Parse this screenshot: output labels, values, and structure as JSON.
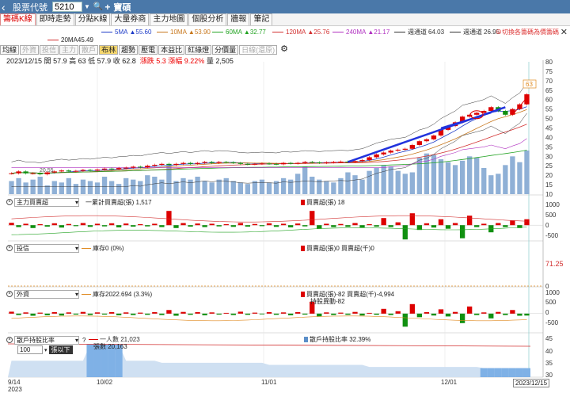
{
  "titlebar": {
    "label": "股票代號",
    "code": "5210",
    "name": "寶碩"
  },
  "tabs": [
    "籌碼K線",
    "即時走勢",
    "分點K線",
    "大量券商",
    "主力地圖",
    "個股分析",
    "牆報",
    "筆記"
  ],
  "ma": [
    {
      "label": "5MA",
      "value": "▲55.60",
      "color": "#1e3cc8"
    },
    {
      "label": "10MA",
      "value": "▲53.90",
      "color": "#c8781e"
    },
    {
      "label": "60MA",
      "value": "▲32.77",
      "color": "#23a323"
    },
    {
      "label": "120MA",
      "value": "▲25.76",
      "color": "#d23030"
    },
    {
      "label": "240MA",
      "value": "▲21.17",
      "color": "#b030c0"
    },
    {
      "label": "週通道",
      "value": "64.03",
      "color": "#333333"
    },
    {
      "label": "週通道",
      "value": "26.95",
      "color": "#333333"
    }
  ],
  "ma_row2": {
    "label": "20MA",
    "value": "45.49",
    "color": "#d23030"
  },
  "link_text": "⊕切換各籌碼為價籌碼",
  "toolbar": [
    "均線",
    "外資",
    "投信",
    "主力",
    "散戶",
    "布林",
    "趨勢",
    "壓電",
    "本益比",
    "紅綠燈",
    "分價量",
    "日線(還原)"
  ],
  "toolbar_dim": [
    1,
    2,
    3,
    4,
    11
  ],
  "toolbar_active": 5,
  "info": {
    "date": "2023/12/15",
    "open": "開 57.9",
    "high": "高 63",
    "low": "低 57.9",
    "close": "收 62.8",
    "chg": "漲跌 5.3",
    "pct": "漲幅 9.22%",
    "vol": "量 2,505"
  },
  "price_axis": [
    "80",
    "75",
    "70",
    "65",
    "60",
    "55",
    "50",
    "45",
    "40",
    "35",
    "30",
    "25",
    "20",
    "15",
    "10"
  ],
  "high_tag": "63",
  "low_tag": "20.55",
  "panels": {
    "main_force": {
      "select": "主力買賣超",
      "line": "一累計買賣超(張) 1,517",
      "bar": "買賣超(張) 18",
      "axis": [
        "1000",
        "500",
        "0",
        "-500"
      ]
    },
    "trust": {
      "select": "投信",
      "line": "庫存0 (0%)",
      "bar": "買賣超(張)0 買賣超(千)0",
      "axis": [
        "0"
      ],
      "price_tag": "71.25"
    },
    "foreign": {
      "select": "外資",
      "line": "庫存2022.694 (3.3%)",
      "bar": "買賣超(張)-82 買賣超(千)-4,994",
      "sub": "持股異動-82",
      "axis": [
        "1000",
        "500",
        "0",
        "-500"
      ]
    },
    "holders": {
      "select": "散戶持股比率",
      "line1": "一人數 21,023",
      "line2": "張數 20,163",
      "bar": "散戶持股比率 32.39%",
      "axis": [
        "45",
        "40",
        "35",
        "30"
      ]
    }
  },
  "pick": {
    "value": "100",
    "label": "張以下"
  },
  "dates": [
    "9/14",
    "10/02",
    "11/01",
    "12/01"
  ],
  "year": "2023",
  "current_date": "2023/12/15",
  "chart_data": {
    "type": "candlestick",
    "ylim": [
      10,
      80
    ],
    "series": [
      {
        "name": "price",
        "values": [
          21,
          22,
          21,
          21,
          20.5,
          21.5,
          22,
          22.5,
          22,
          22.3,
          22.8,
          22.5,
          23,
          23.5,
          23.2,
          23.8,
          24,
          24.5,
          24.2,
          25,
          25.5,
          26,
          25.5,
          26,
          26.5,
          26,
          26.5,
          27,
          26.5,
          27,
          26.8,
          26.5,
          26,
          25.8,
          26,
          26.2,
          26,
          25.8,
          26.5,
          26.2,
          26.5,
          27,
          26.8,
          26.5,
          26.8,
          27,
          27.2,
          27,
          27.5,
          28,
          29.5,
          31,
          32,
          33,
          33.5,
          34,
          36,
          38,
          39,
          41,
          44,
          46,
          48,
          51,
          52,
          53,
          54,
          56,
          54,
          52,
          55,
          57.5,
          62.8
        ]
      },
      {
        "name": "volume",
        "values": [
          9,
          11,
          8,
          10,
          12,
          6,
          9,
          8,
          11,
          7,
          10,
          9,
          8,
          12,
          9,
          7,
          11,
          10,
          9,
          13,
          12,
          10,
          20,
          9,
          11,
          10,
          12,
          9,
          8,
          10,
          11,
          9,
          8,
          7,
          9,
          10,
          8,
          9,
          11,
          10,
          14,
          19,
          12,
          10,
          9,
          8,
          11,
          15,
          13,
          10,
          16,
          18,
          20,
          19,
          16,
          14,
          15,
          25,
          28,
          27,
          24,
          22,
          20,
          23,
          26,
          25,
          18,
          13,
          14,
          20,
          26,
          22,
          30
        ]
      },
      {
        "name": "main_force",
        "values": [
          100,
          -80,
          60,
          -120,
          40,
          -60,
          80,
          -100,
          50,
          -40,
          90,
          -70,
          60,
          -50,
          80,
          -90,
          70,
          -60,
          40,
          -50,
          60,
          -80,
          600,
          -120,
          90,
          -60,
          70,
          -80,
          60,
          -50,
          40,
          -70,
          90,
          -60,
          50,
          -40,
          80,
          -70,
          60,
          -90,
          70,
          -50,
          600,
          -150,
          60,
          -80,
          50,
          -70,
          90,
          -100,
          40,
          -60,
          300,
          -80,
          120,
          -600,
          500,
          -200,
          80,
          -100,
          250,
          -150,
          90,
          -550,
          400,
          -80,
          60,
          -300,
          90,
          -80,
          200,
          -120,
          250
        ]
      },
      {
        "name": "foreign",
        "values": [
          80,
          -60,
          50,
          -90,
          40,
          -70,
          60,
          -80,
          50,
          -40,
          70,
          -60,
          50,
          -40,
          60,
          -70,
          50,
          -60,
          40,
          -50,
          60,
          -60,
          150,
          -90,
          70,
          -50,
          60,
          -70,
          50,
          -40,
          30,
          -60,
          80,
          -50,
          40,
          -30,
          60,
          -50,
          50,
          -70,
          60,
          -40,
          500,
          -120,
          50,
          -60,
          40,
          -50,
          70,
          -80,
          30,
          -50,
          200,
          -60,
          100,
          -550,
          400,
          -150,
          60,
          -80,
          180,
          -120,
          70,
          -400,
          300,
          -60,
          50,
          -200,
          70,
          -60,
          150,
          -90,
          -82
        ]
      },
      {
        "name": "holders",
        "values": [
          36,
          36,
          36,
          36,
          36,
          36,
          36,
          36,
          36,
          36,
          36,
          44,
          44,
          44,
          44,
          44,
          36,
          36,
          36,
          36,
          36,
          35,
          35,
          35,
          35,
          35,
          35,
          35,
          35,
          35,
          35,
          35,
          35,
          35,
          35,
          35,
          34,
          34,
          34,
          34,
          34,
          34,
          34,
          34,
          34,
          34,
          34,
          34,
          34,
          34,
          33,
          33,
          33,
          33,
          33,
          33,
          33,
          33,
          33,
          33,
          33,
          33,
          33,
          33,
          33,
          33,
          32.4,
          32.4,
          32.4,
          32.4,
          32.4,
          32.4,
          32.4
        ]
      }
    ]
  }
}
